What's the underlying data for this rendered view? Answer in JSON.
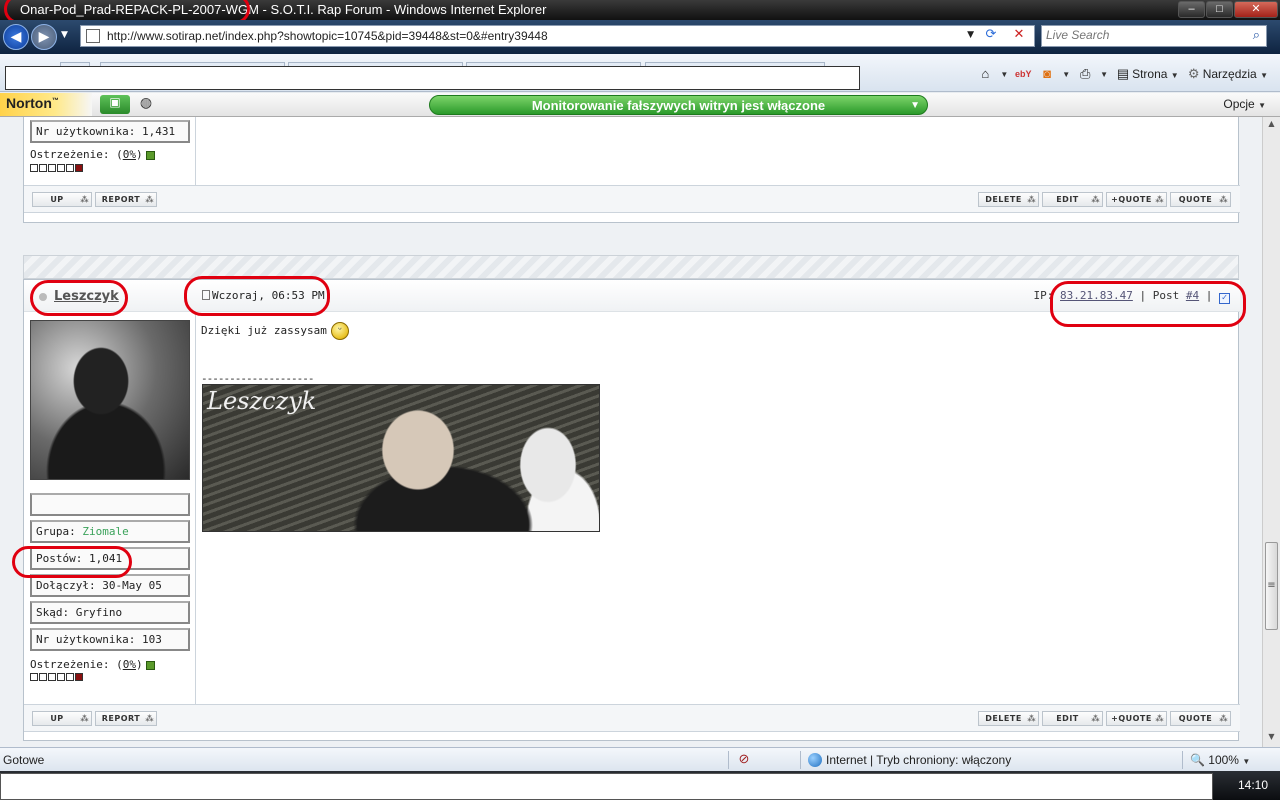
{
  "window": {
    "title": "Onar-Pod_Prad-REPACK-PL-2007-WGM - S.O.T.I. Rap Forum - Windows Internet Explorer",
    "buttons": [
      "minimize-icon",
      "maximize-icon",
      "close-icon"
    ]
  },
  "address_bar": {
    "url": "http://www.sotirap.net/index.php?showtopic=10745&pid=39448&st=0&#entry39448",
    "search_placeholder": "Live Search"
  },
  "command_bar": {
    "page_label": "Strona",
    "tools_label": "Narzędzia",
    "ebay_label": "ebY"
  },
  "norton": {
    "logo": "Norton",
    "status": "Monitorowanie fałszywych witryn jest włączone",
    "options": "Opcje"
  },
  "prev_post": {
    "member_no": "Nr użytkownika: 1,431",
    "warning_label": "Ostrzeżenie: (",
    "warning_value": "0%",
    "warning_close": ")"
  },
  "actions": {
    "up": "UP",
    "report": "REPORT",
    "delete": "DELETE",
    "edit": "EDIT",
    "multiquote": "+QUOTE",
    "quote": "QUOTE"
  },
  "post": {
    "username": "Leszczyk",
    "date": "Wczoraj, 06:53 PM",
    "ip_label": "IP:",
    "ip": "83.21.83.47",
    "post_label": "| Post",
    "post_no": "#4",
    "sep": "|",
    "body": "Dzięki już zassysam",
    "sig_line": "--------------------",
    "sig_image_text": "Leszczyk",
    "group_label": "Grupa:",
    "group_value": "Ziomale",
    "posts": "Postów: 1,041",
    "joined": "Dołączył: 30-May 05",
    "from": "Skąd: Gryfino",
    "member_no": "Nr użytkownika: 103",
    "warning_label": "Ostrzeżenie: (",
    "warning_value": "0%",
    "warning_close": ")"
  },
  "status_bar": {
    "status": "Gotowe",
    "zone": "Internet | Tryb chroniony: włączony",
    "zoom": "100%"
  },
  "taskbar": {
    "clock": "14:10"
  },
  "colors": {
    "group_color": "#3aa25a",
    "annotation_red": "#e00010",
    "norton_green": "#2b9a2b"
  }
}
